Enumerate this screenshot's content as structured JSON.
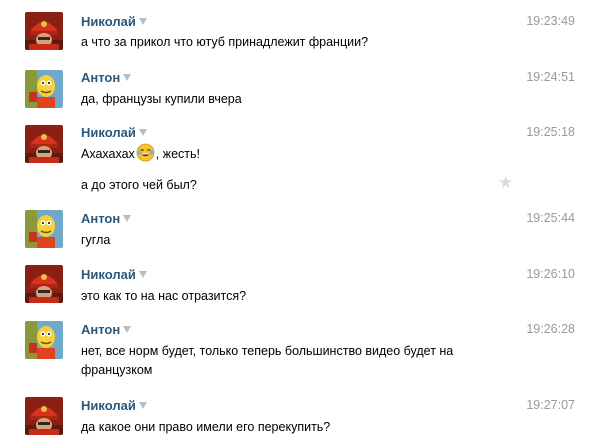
{
  "messages": [
    {
      "author": "Николай",
      "avatar": "red-firefighter-avatar",
      "time": "19:23:49",
      "lines": [
        "а что за прикол что ютуб принадлежит франции?"
      ]
    },
    {
      "author": "Антон",
      "avatar": "yellow-cartoon-avatar",
      "time": "19:24:51",
      "lines": [
        "да, французы купили вчера"
      ]
    },
    {
      "author": "Николай",
      "avatar": "red-firefighter-avatar",
      "time": "19:25:18",
      "lines": [
        "Ахахахах",
        ", жесть!"
      ],
      "emoji": "laughing-tears-emoji",
      "extra_line": "а до этого чей был?",
      "star_icon": "star-icon"
    },
    {
      "author": "Антон",
      "avatar": "yellow-cartoon-avatar",
      "time": "19:25:44",
      "lines": [
        "гугла"
      ]
    },
    {
      "author": "Николай",
      "avatar": "red-firefighter-avatar",
      "time": "19:26:10",
      "lines": [
        "это как то на нас отразится?"
      ]
    },
    {
      "author": "Антон",
      "avatar": "yellow-cartoon-avatar",
      "time": "19:26:28",
      "lines": [
        "нет, все норм будет, только теперь большинство видео будет на",
        "французком"
      ]
    },
    {
      "author": "Николай",
      "avatar": "red-firefighter-avatar",
      "time": "19:27:07",
      "lines": [
        "да какое они право имели его перекупить?"
      ]
    }
  ],
  "colors": {
    "author_link": "#2b587a",
    "timestamp": "#999999",
    "star": "#d6dbe0"
  }
}
